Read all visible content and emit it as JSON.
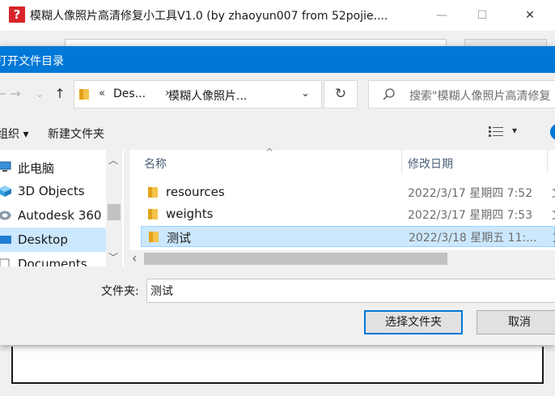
{
  "app": {
    "title": "模糊人像照片高清修复小工具V1.0  (by zhaoyun007 from 52pojie....",
    "icon_glyph": "?",
    "minimize_glyph": "—",
    "maximize_glyph": "☐",
    "close_glyph": "✕"
  },
  "dialog": {
    "title": "打开文件目录",
    "nav": {
      "back_glyph": "←",
      "forward_glyph": "→",
      "recent_glyph": "⌄",
      "up_glyph": "↑"
    },
    "address": {
      "overflow": "«",
      "crumb1": "Des...",
      "arrow": "›",
      "crumb2": "模糊人像照片...",
      "dropdown_glyph": "⌄"
    },
    "refresh_glyph": "↻",
    "search_placeholder": "搜索\"模糊人像照片高清修复",
    "commands": {
      "organize": "组织 ▾",
      "new_folder": "新建文件夹",
      "view_dropdown": "▾"
    },
    "nav_pane": {
      "items": [
        {
          "label": "此电脑",
          "icon": "this-pc-icon"
        },
        {
          "label": "3D Objects",
          "icon": "3d-objects-icon"
        },
        {
          "label": "Autodesk 360",
          "icon": "autodesk-360-icon"
        },
        {
          "label": "Desktop",
          "icon": "desktop-icon",
          "selected": true
        },
        {
          "label": "Documents",
          "icon": "documents-icon"
        }
      ],
      "scroll_up": "︿",
      "scroll_down": "﹀"
    },
    "columns": {
      "name": "名称",
      "modified": "修改日期",
      "sort_indicator": "^"
    },
    "files": [
      {
        "name": "resources",
        "modified": "2022/3/17 星期四 7:52",
        "cut": "文"
      },
      {
        "name": "weights",
        "modified": "2022/3/17 星期四 7:53",
        "cut": "文"
      },
      {
        "name": "测试",
        "modified": "2022/3/18 星期五 11:...",
        "cut": "文",
        "selected": true
      }
    ],
    "hscroll_left": "‹",
    "folder_label": "文件夹:",
    "folder_value": "测试",
    "buttons": {
      "select": "选择文件夹",
      "cancel": "取消"
    }
  },
  "colors": {
    "accent": "#0078d7",
    "selection": "#cce8ff",
    "folder": "#f4c34c"
  }
}
